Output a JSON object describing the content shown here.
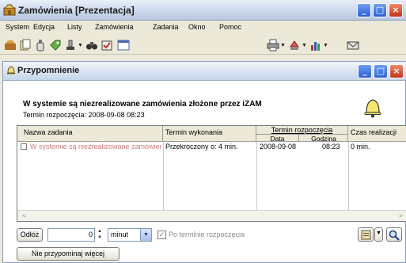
{
  "window": {
    "title": "Zamówienia [Prezentacja]"
  },
  "menu": [
    {
      "label": "System",
      "u": "S"
    },
    {
      "label": "Edycja",
      "u": "E"
    },
    {
      "label": "Listy",
      "u": "L"
    },
    {
      "label": "Zamówienia",
      "u": "Z"
    },
    {
      "label": "Zadania",
      "u": "n"
    },
    {
      "label": "Okno",
      "u": "O"
    },
    {
      "label": "Pomoc",
      "u": "P"
    }
  ],
  "toolbar_icons": [
    "orders-icon",
    "documents-icon",
    "bottle-icon",
    "tag-icon",
    "stamp-icon",
    "binoculars-icon",
    "reminder-icon",
    "calendar-icon",
    "printer-icon",
    "export-icon",
    "chart-icon",
    "envelope-icon"
  ],
  "child": {
    "title": "Przypomnienie",
    "headline": "W systemie są niezrealizowane zamówienia złożone przez iZAM",
    "start_label": "Termin rozpoczęcia:",
    "start_value": "2008-09-08 08:23"
  },
  "grid": {
    "columns": {
      "task_name": "Nazwa zadania",
      "due": "Termin wykonania",
      "start": "Termin rozpoczęcia",
      "start_date": "Data",
      "start_time": "Godzina",
      "duration": "Czas realizacji"
    },
    "rows": [
      {
        "checked": false,
        "task_name": "W systemie są niezrealizowane zamówienia z",
        "due": "Przekroczony o: 4 min.",
        "date": "2008-09-08",
        "time": "08:23",
        "duration": "0 min."
      }
    ]
  },
  "controls": {
    "postpone_label": "Odłóż",
    "postpone_amount": "0",
    "unit": "minut",
    "after_start_checked": true,
    "after_start_label": "Po terminie rozpoczęcia",
    "dont_remind_label": "Nie przypominaj więcej"
  },
  "colors": {
    "task_name_text": "#d27a7a",
    "title_gradient_top": "#e9eff8",
    "close_button": "#c5311a"
  }
}
